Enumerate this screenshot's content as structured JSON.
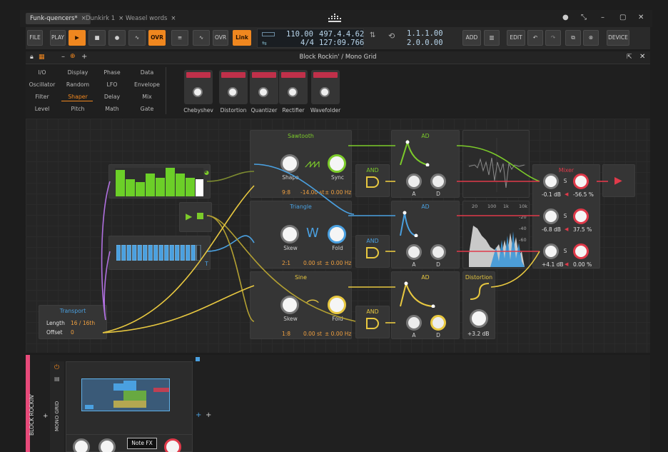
{
  "tabs": [
    {
      "label": "Funk-quencers*",
      "active": true
    },
    {
      "label": "Dunkirk 1",
      "active": false
    },
    {
      "label": "Weasel words",
      "active": false
    }
  ],
  "toolbar": {
    "file": "FILE",
    "play": "PLAY",
    "ovr": "OVR",
    "ovr2": "OVR",
    "link": "Link",
    "tempo": "110.00",
    "position": "497.4.4.62",
    "meter": "4/4",
    "time": "127:09.766",
    "loop_start": "1.1.1.00",
    "loop_end": "2.0.0.00",
    "add": "ADD",
    "edit": "EDIT",
    "device": "DEVICE"
  },
  "device": {
    "title": "Block Rockin' / Mono Grid"
  },
  "categories": {
    "col1": [
      "I/O",
      "Oscillator",
      "Filter",
      "Level"
    ],
    "col2": [
      "Display",
      "Random",
      "Shaper",
      "Pitch"
    ],
    "col3": [
      "Phase",
      "LFO",
      "Delay",
      "Math"
    ],
    "col4": [
      "Data",
      "Envelope",
      "Mix",
      "Gate"
    ],
    "selected": "Shaper"
  },
  "shapers": [
    "Chebyshev",
    "Distortion",
    "Quantizer",
    "Rectifier",
    "Wavefolder"
  ],
  "modules": {
    "sawtooth": {
      "title": "Sawtooth",
      "shape": "Shape",
      "sync": "Sync",
      "ratio": "9:8",
      "st": "-14.00 st",
      "hz": "± 0.00 Hz"
    },
    "triangle": {
      "title": "Triangle",
      "skew": "Skew",
      "fold": "Fold",
      "ratio": "2:1",
      "st": "0.00 st",
      "hz": "± 0.00 Hz"
    },
    "sine": {
      "title": "Sine",
      "skew": "Skew",
      "fold": "Fold",
      "ratio": "1:8",
      "st": "0.00 st",
      "hz": "± 0.00 Hz"
    },
    "and1": "AND",
    "and2": "AND",
    "and3": "AND",
    "ad1": {
      "title": "AD",
      "a": "A",
      "d": "D"
    },
    "ad2": {
      "title": "AD",
      "a": "A",
      "d": "D"
    },
    "ad3": {
      "title": "AD",
      "a": "A",
      "d": "D"
    },
    "mixer": {
      "title": "Mixer",
      "s": "S",
      "rows": [
        {
          "db": "-0.1 dB",
          "pan": "-56.5 %"
        },
        {
          "db": "-6.8 dB",
          "pan": "37.5 %"
        },
        {
          "db": "+4.1 dB",
          "pan": "0.00 %"
        }
      ]
    },
    "distortion": {
      "title": "Distortion",
      "gain": "+3.2 dB"
    },
    "transport": {
      "title": "Transport",
      "length_label": "Length",
      "length_value": "16 / 16th",
      "offset_label": "Offset",
      "offset_value": "0"
    },
    "spectrum_ticks": [
      "20",
      "100",
      "1k",
      "10k"
    ],
    "db_ticks": [
      "-20",
      "-40",
      "-60"
    ],
    "seq_t": "T"
  },
  "bottom": {
    "track": "BLOCK ROCKIN'",
    "device": "MONO GRID",
    "notefx": "Note FX"
  },
  "colors": {
    "accent": "#f0871f",
    "green": "#7ccb2a",
    "blue": "#4aa0e0",
    "yellow": "#e8c840",
    "red": "#e03a4a",
    "purple": "#b070e0"
  }
}
